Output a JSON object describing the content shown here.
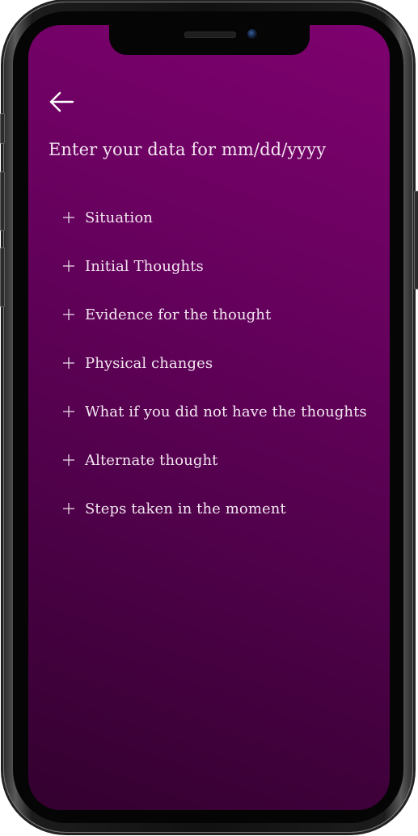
{
  "header": {
    "title": "Enter your data for mm/dd/yyyy"
  },
  "icons": {
    "back": "arrow-left-icon",
    "expand": "plus-icon"
  },
  "colors": {
    "background_top": "#7e016f",
    "background_bottom": "#33012f",
    "text": "#f2e6f0"
  },
  "items": [
    {
      "label": "Situation"
    },
    {
      "label": "Initial Thoughts"
    },
    {
      "label": "Evidence for the thought"
    },
    {
      "label": "Physical changes"
    },
    {
      "label": "What if you did not have the thoughts"
    },
    {
      "label": "Alternate thought"
    },
    {
      "label": "Steps taken in the moment"
    }
  ]
}
